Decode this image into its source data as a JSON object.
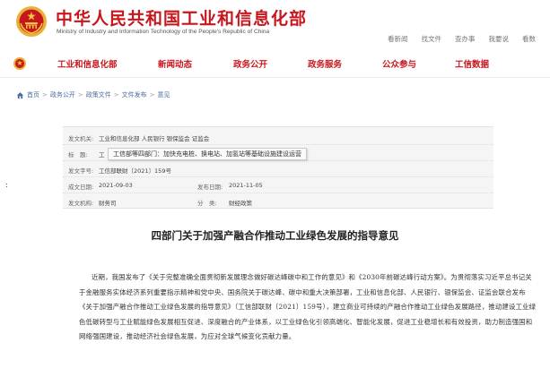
{
  "header": {
    "title": "中华人民共和国工业和信息化部",
    "subtitle": "Ministry of Industry and Information Technology of the People's Republic of China",
    "links": [
      "看新闻",
      "找文件",
      "查办事",
      "我要说",
      "看数"
    ]
  },
  "nav": {
    "items": [
      "工业和信息化部",
      "新闻动态",
      "政务公开",
      "政务服务",
      "公众参与",
      "工信数据"
    ]
  },
  "breadcrumb": {
    "items": [
      "首页",
      "政务公开",
      "政策文件",
      "文件发布",
      "意见"
    ],
    "separator": ">"
  },
  "meta": {
    "issuer_label": "发文机关:",
    "issuer_value": "工业和信息化部 人民银行 银保监会 证监会",
    "title_label": "标　题:",
    "title_value": "工",
    "doc_no_label": "发文字号:",
    "doc_no_value": "工信部联财〔2021〕159号",
    "date_label": "成文日期:",
    "date_value": "2021-09-03",
    "pub_label": "发布日期:",
    "pub_value": "2021-11-05",
    "org_label": "发文机构:",
    "org_value": "财务司",
    "cat_label": "分　类:",
    "cat_value": "财经政策"
  },
  "tooltip": {
    "text": "工信部等四部门：加快充电桩、换电站、加氢站等基础设施建设运营"
  },
  "side_mark": ":",
  "article": {
    "title": "四部门关于加强产融合作推动工业绿色发展的指导意见",
    "body": "近期，我国发布了《关于完整准确全面贯彻新发展理念做好碳达峰碳中和工作的意见》和《2030年前碳达峰行动方案》。为贯彻落实习近平总书记关于金融服务实体经济系列重要指示精神和党中央、国务院关于碳达峰、碳中和重大决策部署，工业和信息化部、人民银行、银保监会、证监会联合发布《关于加强产融合作推动工业绿色发展的指导意见》（工信部联财〔2021〕159号），建立商业可持续的产融合作推动工业绿色发展路径，推动建设工业绿色低碳转型与工业赋能绿色发展相互促进、深度融合的产业体系，以工业绿色化引领高端化、智能化发展，促进工业稳增长和有效投资，助力制造强国和网络强国建设，推动经济社会绿色发展，为应对全球气候变化贡献力量。"
  },
  "colors": {
    "brand_red": "#c8161d",
    "link_blue": "#4a6a9c",
    "meta_bg": "#f5f5f5"
  },
  "icons": {
    "emblem": "national-emblem-icon",
    "home": "home-icon"
  }
}
